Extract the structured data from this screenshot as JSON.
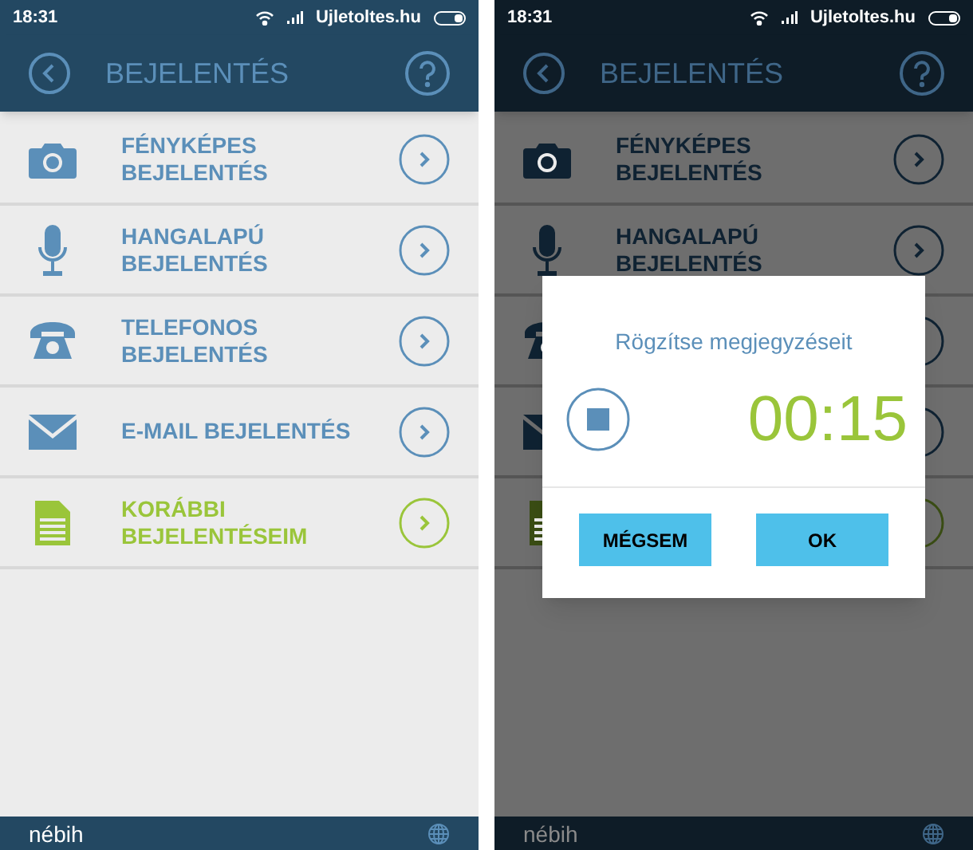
{
  "screens": [
    {
      "status_bar": {
        "time": "18:31",
        "carrier": "Ujletoltes.hu"
      },
      "header": {
        "title": "BEJELENTÉS"
      },
      "dimmed": false,
      "items": [
        {
          "kind": "camera",
          "label": "FÉNYKÉPES\nBEJELENTÉS",
          "color": "#5b8fb9"
        },
        {
          "kind": "microphone",
          "label": "HANGALAPÚ\nBEJELENTÉS",
          "color": "#5b8fb9"
        },
        {
          "kind": "phone",
          "label": "TELEFONOS\nBEJELENTÉS",
          "color": "#5b8fb9"
        },
        {
          "kind": "mail",
          "label": "E-MAIL BEJELENTÉS",
          "color": "#5b8fb9"
        },
        {
          "kind": "document",
          "label": "KORÁBBI\nBEJELENTÉSEIM",
          "color": "#9ac53a"
        }
      ],
      "footer": {
        "logo": "nébih"
      }
    },
    {
      "status_bar": {
        "time": "18:31",
        "carrier": "Ujletoltes.hu"
      },
      "header": {
        "title": "BEJELENTÉS"
      },
      "dimmed": true,
      "items": [
        {
          "kind": "camera",
          "label": "FÉNYKÉPES\nBEJELENTÉS",
          "color": "#0f2232"
        },
        {
          "kind": "microphone",
          "label": "HANGALAPÚ\nBEJELENTÉS",
          "color": "#0f2232"
        },
        {
          "kind": "phone",
          "color": "#0f2232"
        },
        {
          "kind": "mail",
          "color": "#0f2232"
        },
        {
          "kind": "document",
          "color": "#3a4d14"
        }
      ],
      "footer": {
        "logo": "nébih"
      },
      "dialog": {
        "title": "Rögzítse megjegyzéseit",
        "timer": "00:15",
        "buttons": [
          "MÉGSEM",
          "OK"
        ]
      }
    }
  ]
}
